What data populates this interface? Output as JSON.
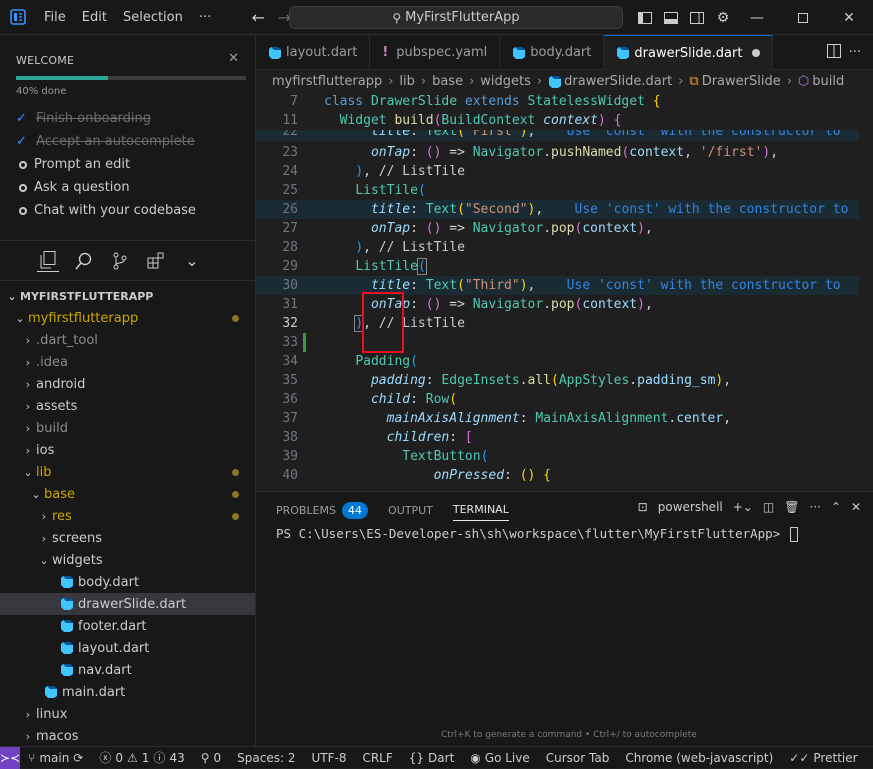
{
  "titlebar": {
    "menus": [
      "File",
      "Edit",
      "Selection",
      "···"
    ],
    "search": "MyFirstFlutterApp"
  },
  "welcome": {
    "title": "WELCOME",
    "progress_text": "40% done",
    "progress": 0.4,
    "tasks": [
      {
        "label": "Finish onboarding",
        "done": true
      },
      {
        "label": "Accept an autocomplete",
        "done": true
      },
      {
        "label": "Prompt an edit",
        "done": false
      },
      {
        "label": "Ask a question",
        "done": false
      },
      {
        "label": "Chat with your codebase",
        "done": false
      }
    ]
  },
  "explorer": {
    "root": "MYFIRSTFLUTTERAPP",
    "items": [
      {
        "label": "myfirstflutterapp",
        "depth": 1,
        "type": "folder-open",
        "mod": true
      },
      {
        "label": ".dart_tool",
        "depth": 2,
        "type": "folder",
        "dim": true
      },
      {
        "label": ".idea",
        "depth": 2,
        "type": "folder",
        "dim": true
      },
      {
        "label": "android",
        "depth": 2,
        "type": "folder"
      },
      {
        "label": "assets",
        "depth": 2,
        "type": "folder"
      },
      {
        "label": "build",
        "depth": 2,
        "type": "folder",
        "dim": true
      },
      {
        "label": "ios",
        "depth": 2,
        "type": "folder"
      },
      {
        "label": "lib",
        "depth": 2,
        "type": "folder-open",
        "mod": true
      },
      {
        "label": "base",
        "depth": 3,
        "type": "folder-open",
        "mod": true
      },
      {
        "label": "res",
        "depth": 4,
        "type": "folder",
        "mod": true
      },
      {
        "label": "screens",
        "depth": 4,
        "type": "folder"
      },
      {
        "label": "widgets",
        "depth": 4,
        "type": "folder-open"
      },
      {
        "label": "body.dart",
        "depth": 5,
        "type": "dart"
      },
      {
        "label": "drawerSlide.dart",
        "depth": 5,
        "type": "dart",
        "selected": true
      },
      {
        "label": "footer.dart",
        "depth": 5,
        "type": "dart"
      },
      {
        "label": "layout.dart",
        "depth": 5,
        "type": "dart"
      },
      {
        "label": "nav.dart",
        "depth": 5,
        "type": "dart"
      },
      {
        "label": "main.dart",
        "depth": 3,
        "type": "dart"
      },
      {
        "label": "linux",
        "depth": 2,
        "type": "folder"
      },
      {
        "label": "macos",
        "depth": 2,
        "type": "folder"
      }
    ]
  },
  "tabs": [
    {
      "label": "layout.dart",
      "icon": "dart"
    },
    {
      "label": "pubspec.yaml",
      "icon": "yaml"
    },
    {
      "label": "body.dart",
      "icon": "dart"
    },
    {
      "label": "drawerSlide.dart",
      "icon": "dart",
      "active": true,
      "modified": true
    }
  ],
  "breadcrumb": [
    "myfirstflutterapp",
    "lib",
    "base",
    "widgets",
    "drawerSlide.dart",
    "DrawerSlide",
    "build"
  ],
  "editor": {
    "sticky": [
      {
        "n": "7",
        "text": "class DrawerSlide extends StatelessWidget {"
      },
      {
        "n": "11",
        "text": "  Widget build(BuildContext context) {"
      }
    ],
    "lines": [
      "22",
      "23",
      "24",
      "25",
      "26",
      "27",
      "28",
      "29",
      "30",
      "31",
      "32",
      "33",
      "34",
      "35",
      "36",
      "37",
      "38",
      "39",
      "40"
    ],
    "hint": "Use 'const' with the constructor to"
  },
  "panel": {
    "tabs": [
      "PROBLEMS",
      "OUTPUT",
      "TERMINAL"
    ],
    "problems_count": "44",
    "shell": "powershell",
    "prompt": "PS C:\\Users\\ES-Developer-sh\\sh\\workspace\\flutter\\MyFirstFlutterApp>",
    "hint": "Ctrl+K to generate a command • Ctrl+/ to autocomplete"
  },
  "status": {
    "branch": "main",
    "errors": "0",
    "warnings": "1",
    "infos": "43",
    "ports": "0",
    "spaces": "Spaces: 2",
    "encoding": "UTF-8",
    "eol": "CRLF",
    "language": "Dart",
    "golive": "Go Live",
    "cursor_tab": "Cursor Tab",
    "debug": "Chrome (web-javascript)",
    "prettier": "Prettier"
  }
}
